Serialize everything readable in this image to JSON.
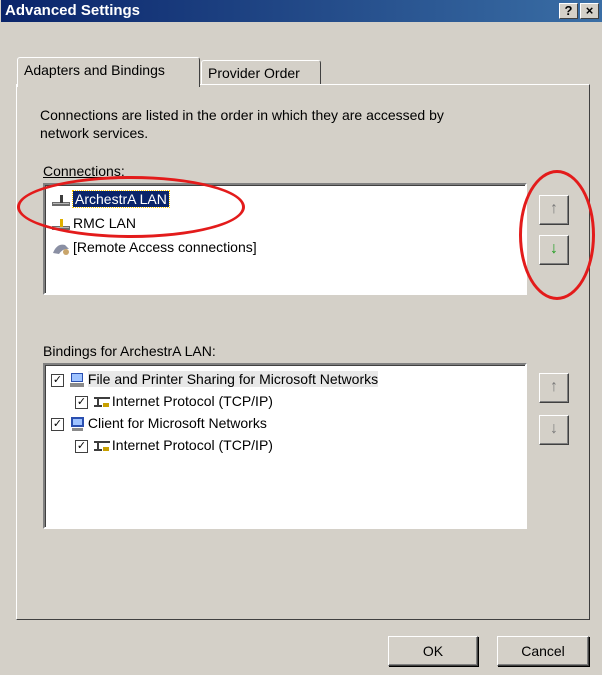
{
  "window": {
    "title": "Advanced Settings",
    "help_button": "?",
    "close_button": "×"
  },
  "tabs": [
    {
      "label": "Adapters and Bindings",
      "active": true
    },
    {
      "label": "Provider Order",
      "active": false
    }
  ],
  "intro_text": {
    "line1": "Connections are listed in the order in which they are accessed by",
    "line2": "network services."
  },
  "connections": {
    "label": "Connections:",
    "items": [
      {
        "label": "ArchestrA LAN",
        "selected": true,
        "icon": "network-adapter-icon"
      },
      {
        "label": "RMC LAN",
        "selected": false,
        "icon": "network-adapter-icon"
      },
      {
        "label": "[Remote Access connections]",
        "selected": false,
        "icon": "remote-access-icon"
      }
    ],
    "move_up": "↑",
    "move_down": "↓"
  },
  "bindings": {
    "label": "Bindings for ArchestrA LAN:",
    "items": [
      {
        "label": "File and Printer Sharing for Microsoft Networks",
        "checked": true,
        "icon": "printer-sharing-icon",
        "level": 0
      },
      {
        "label": "Internet Protocol (TCP/IP)",
        "checked": true,
        "icon": "protocol-icon",
        "level": 1
      },
      {
        "label": "Client for Microsoft Networks",
        "checked": true,
        "icon": "network-client-icon",
        "level": 0
      },
      {
        "label": "Internet Protocol (TCP/IP)",
        "checked": true,
        "icon": "protocol-icon",
        "level": 1
      }
    ],
    "move_up": "↑",
    "move_down": "↓"
  },
  "footer": {
    "ok_label": "OK",
    "cancel_label": "Cancel"
  },
  "colors": {
    "face": "#d4d0c8",
    "title_start": "#0a246a",
    "title_end": "#3a6ea5",
    "selection": "#0a246a",
    "annotation": "#e31b1b",
    "green_arrow": "#1f9d1f"
  }
}
